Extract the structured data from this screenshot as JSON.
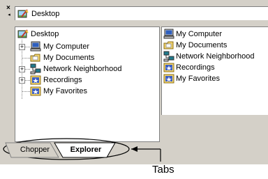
{
  "window": {
    "close_glyph": "×",
    "address_icon": "desktop-icon",
    "address_value": "Desktop"
  },
  "tree": {
    "root": {
      "label": "Desktop",
      "icon": "desktop-icon"
    },
    "items": [
      {
        "label": "My Computer",
        "icon": "computer-icon",
        "expander": "+"
      },
      {
        "label": "My Documents",
        "icon": "folder-icon",
        "expander": ""
      },
      {
        "label": "Network Neighborhood",
        "icon": "network-icon",
        "expander": "+"
      },
      {
        "label": "Recordings",
        "icon": "star-folder-icon",
        "expander": "+"
      },
      {
        "label": "My Favorites",
        "icon": "star-folder-icon",
        "expander": ""
      }
    ]
  },
  "list": {
    "items": [
      {
        "label": "My Computer",
        "icon": "computer-icon"
      },
      {
        "label": "My Documents",
        "icon": "folder-icon"
      },
      {
        "label": "Network Neighborhood",
        "icon": "network-icon"
      },
      {
        "label": "Recordings",
        "icon": "star-folder-icon"
      },
      {
        "label": "My Favorites",
        "icon": "star-folder-icon"
      }
    ]
  },
  "tabs": [
    {
      "label": "Chopper",
      "active": false
    },
    {
      "label": "Explorer",
      "active": true
    }
  ],
  "annotation": {
    "callout_label": "Tabs"
  },
  "colors": {
    "chrome": "#d4d0c8",
    "pane_bg": "#ffffff",
    "folder_yellow": "#f5d66b",
    "computer_blue": "#2e5fbf",
    "network_teal": "#1f7a8c"
  }
}
